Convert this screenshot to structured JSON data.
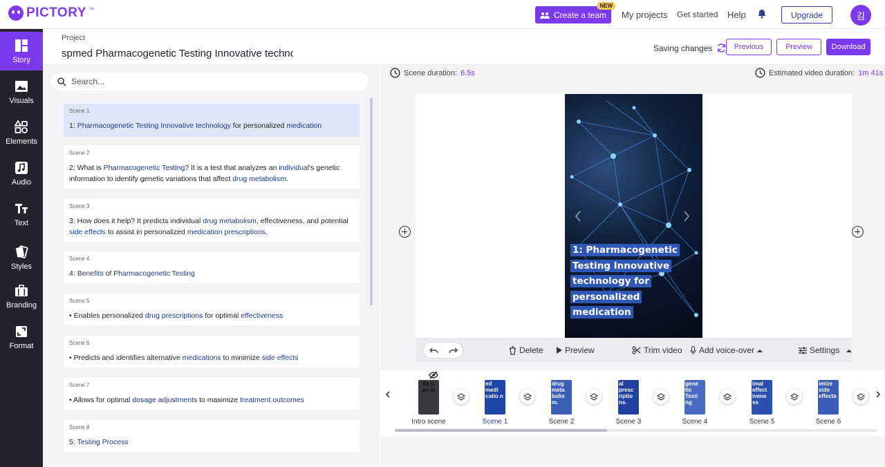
{
  "brand": {
    "name": "PICTORY",
    "tm": "™",
    "accent": "#7c3aed"
  },
  "topnav": {
    "create_team": "Create a team",
    "new_badge": "NEW",
    "links": [
      "My projects",
      "Get started",
      "Help"
    ],
    "upgrade": "Upgrade",
    "avatar": "김"
  },
  "sidebar": {
    "items": [
      {
        "label": "Story",
        "icon": "story-icon",
        "active": true
      },
      {
        "label": "Visuals",
        "icon": "image-icon"
      },
      {
        "label": "Elements",
        "icon": "shapes-icon"
      },
      {
        "label": "Audio",
        "icon": "music-icon"
      },
      {
        "label": "Text",
        "icon": "text-icon"
      },
      {
        "label": "Styles",
        "icon": "cards-icon"
      },
      {
        "label": "Branding",
        "icon": "briefcase-icon"
      },
      {
        "label": "Format",
        "icon": "aspect-ratio-icon"
      }
    ]
  },
  "project": {
    "label": "Project",
    "title": "spmed Pharmacogenetic Testing Innovative technolo",
    "saving": "Saving changes",
    "previous": "Previous",
    "preview": "Preview",
    "download": "Download"
  },
  "search": {
    "placeholder": "Search..."
  },
  "scenes": [
    {
      "num": "Scene 1",
      "parts": [
        [
          "1: ",
          0
        ],
        [
          "Pharmacogenetic Testing Innovative technology",
          1
        ],
        [
          " for personalized ",
          0
        ],
        [
          "medication",
          1
        ]
      ]
    },
    {
      "num": "Scene 2",
      "parts": [
        [
          "2: What is ",
          0
        ],
        [
          "Pharmacogenetic Testing",
          1
        ],
        [
          "? It is a test that analyzes an ",
          0
        ],
        [
          "individual",
          1
        ],
        [
          "'s genetic information to identify genetic variations that affect ",
          0
        ],
        [
          "drug metabolism",
          1
        ],
        [
          ".",
          0
        ]
      ]
    },
    {
      "num": "Scene 3",
      "parts": [
        [
          "3: How does it help? It predicts individual ",
          0
        ],
        [
          "drug metabolism",
          1
        ],
        [
          ", effectiveness, and potential ",
          0
        ],
        [
          "side effects",
          1
        ],
        [
          " to assist in personalized ",
          0
        ],
        [
          "medication prescriptions",
          1
        ],
        [
          ".",
          0
        ]
      ]
    },
    {
      "num": "Scene 4",
      "parts": [
        [
          "4: ",
          0
        ],
        [
          "Benefits",
          1
        ],
        [
          " of ",
          0
        ],
        [
          "Pharmacogenetic Testing",
          1
        ]
      ]
    },
    {
      "num": "Scene 5",
      "parts": [
        [
          "• Enables personalized ",
          0
        ],
        [
          "drug prescriptions",
          1
        ],
        [
          " for optimal ",
          0
        ],
        [
          "effectiveness",
          1
        ]
      ]
    },
    {
      "num": "Scene 6",
      "parts": [
        [
          "• Predicts and identifies alternative ",
          0
        ],
        [
          "medications",
          1
        ],
        [
          " to minimize ",
          0
        ],
        [
          "side effects",
          1
        ]
      ]
    },
    {
      "num": "Scene 7",
      "parts": [
        [
          "• Allows for optimal ",
          0
        ],
        [
          "dosage adjustments",
          1
        ],
        [
          " to maximize ",
          0
        ],
        [
          "treatment outcomes",
          1
        ]
      ]
    },
    {
      "num": "Scene 8",
      "parts": [
        [
          "5: ",
          0
        ],
        [
          "Testing Process",
          1
        ]
      ]
    }
  ],
  "preview": {
    "scene_duration_label": "Scene duration:",
    "scene_duration": "6.5s",
    "est_duration_label": "Estimated video duration:",
    "est_duration": "1m 41s",
    "caption_lines": [
      "1: Pharmacogenetic",
      "Testing Innovative",
      "technology for",
      "personalized",
      "medication"
    ]
  },
  "toolbar": {
    "delete": "Delete",
    "preview": "Preview",
    "trim": "Trim video",
    "voiceover": "Add voice-over",
    "settings": "Settings"
  },
  "timeline": {
    "items": [
      {
        "label": "Intro scene",
        "thumb_text": "da y, an et"
      },
      {
        "label": "Scene 1",
        "thumb_text": "ed medi catio n",
        "active": true
      },
      {
        "label": "Scene 2",
        "thumb_text": "drug meta bolis m."
      },
      {
        "label": "Scene 3",
        "thumb_text": "al presc riptio ns."
      },
      {
        "label": "Scene 4",
        "thumb_text": "gene tic Testi ng"
      },
      {
        "label": "Scene 5",
        "thumb_text": "imal effect ivene ss"
      },
      {
        "label": "Scene 6",
        "thumb_text": "imize side effects"
      }
    ]
  }
}
